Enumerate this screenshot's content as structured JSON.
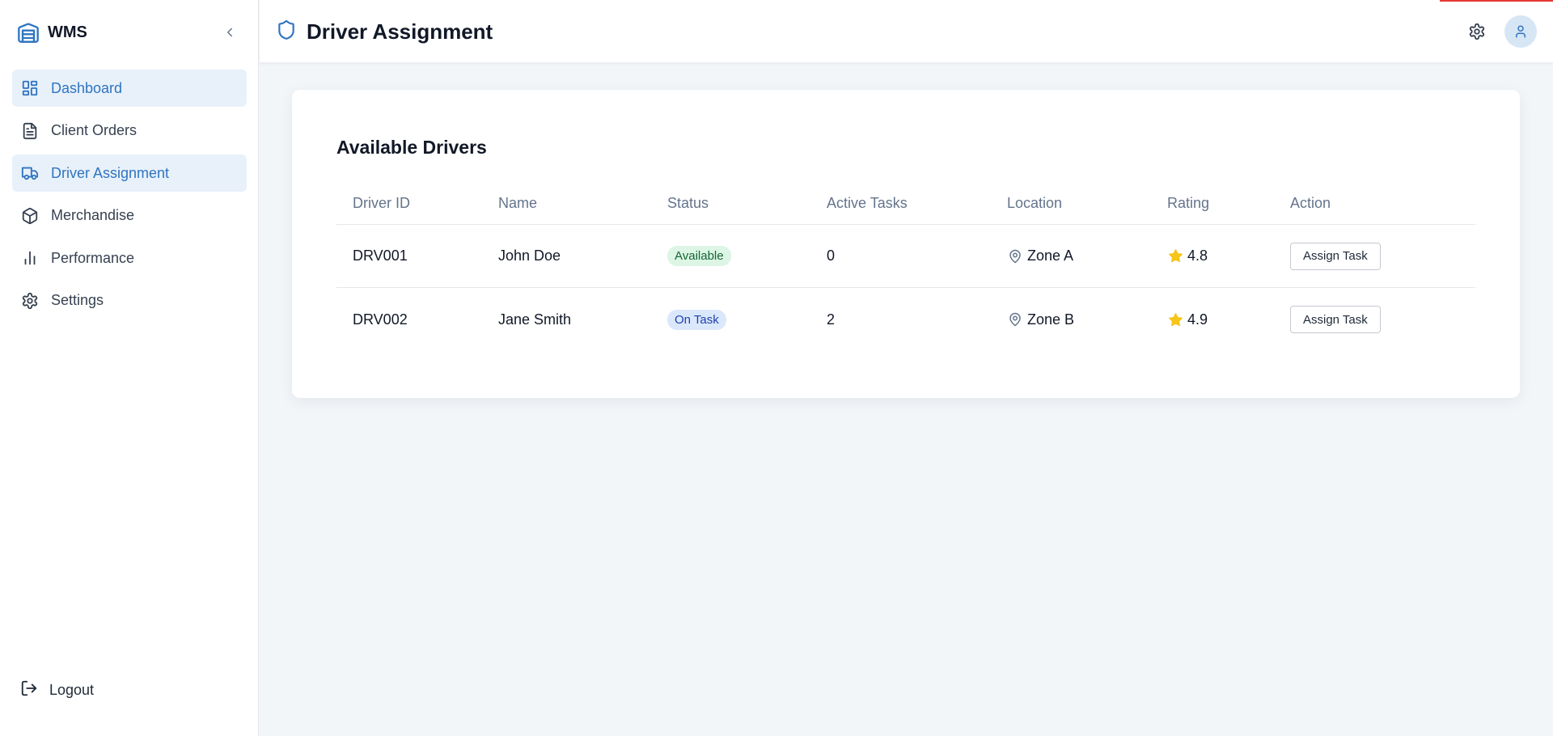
{
  "app": {
    "name": "WMS"
  },
  "colors": {
    "accent": "#2f74c0",
    "active_bg": "#e8f1fa",
    "available_bg": "#dcf5e5",
    "ontask_bg": "#dbe8fb",
    "star": "#f5c518"
  },
  "sidebar": {
    "items": [
      {
        "label": "Dashboard",
        "icon": "dashboard-icon",
        "active": true
      },
      {
        "label": "Client Orders",
        "icon": "document-icon",
        "active": false
      },
      {
        "label": "Driver Assignment",
        "icon": "truck-icon",
        "active": true
      },
      {
        "label": "Merchandise",
        "icon": "box-icon",
        "active": false
      },
      {
        "label": "Performance",
        "icon": "bar-chart-icon",
        "active": false
      },
      {
        "label": "Settings",
        "icon": "gear-icon",
        "active": false
      }
    ],
    "logout_label": "Logout"
  },
  "header": {
    "title": "Driver Assignment"
  },
  "card": {
    "title": "Available Drivers",
    "columns": [
      "Driver ID",
      "Name",
      "Status",
      "Active Tasks",
      "Location",
      "Rating",
      "Action"
    ],
    "rows": [
      {
        "id": "DRV001",
        "name": "John Doe",
        "status": "Available",
        "active_tasks": "0",
        "location": "Zone A",
        "rating": "4.8",
        "action": "Assign Task"
      },
      {
        "id": "DRV002",
        "name": "Jane Smith",
        "status": "On Task",
        "active_tasks": "2",
        "location": "Zone B",
        "rating": "4.9",
        "action": "Assign Task"
      }
    ]
  }
}
